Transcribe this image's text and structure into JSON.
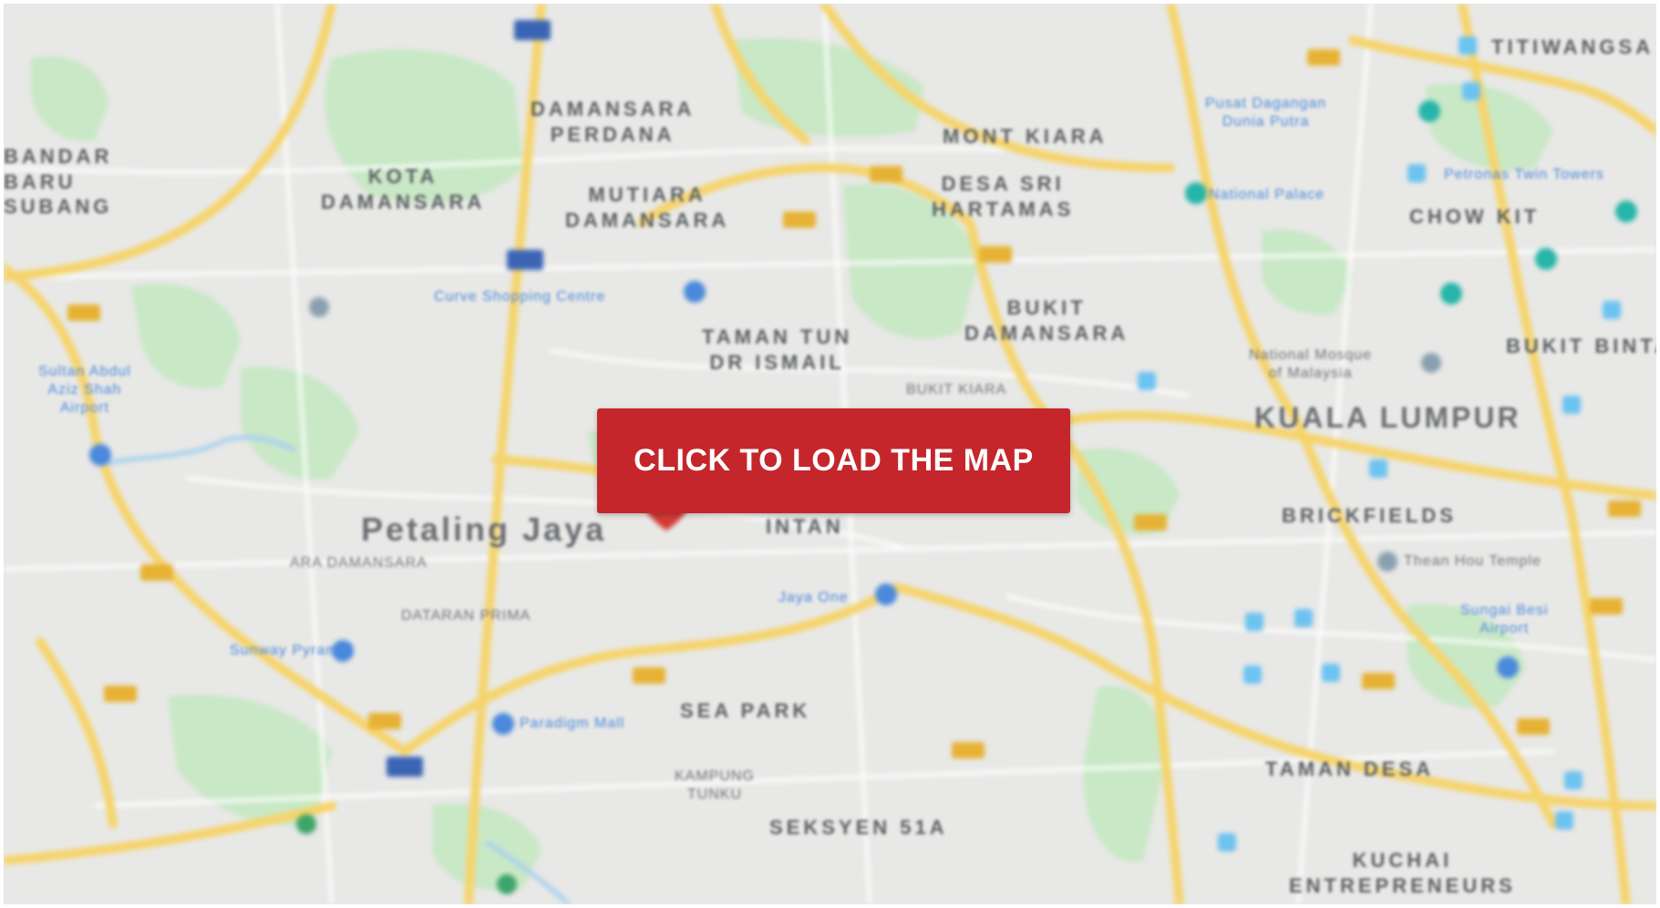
{
  "map": {
    "button_label": "CLICK TO LOAD THE MAP",
    "colors": {
      "land": "#e8e8e6",
      "park": "#c9e8c6",
      "highway": "#f6d46b",
      "road": "#ffffff",
      "button": "#c4262c",
      "pin": "#d23a35",
      "poi_blue": "#4a89dc",
      "poi_teal": "#26b5a8"
    },
    "areas": [
      "BANDAR\nBARU\nSUBANG",
      "KOTA\nDAMANSARA",
      "DAMANSARA\nPERDANA",
      "MUTIARA\nDAMANSARA",
      "MONT KIARA",
      "DESA SRI\nHARTAMAS",
      "TAMAN TUN\nDR ISMAIL",
      "BUKIT\nDAMANSARA",
      "BUKIT KIARA",
      "KUALA LUMPUR",
      "BRICKFIELDS",
      "CHOW KIT",
      "BUKIT BINTANG",
      "TITIWANGSA",
      "INTAN",
      "SEA PARK",
      "SEKSYEN 51A",
      "TAMAN DESA",
      "KUCHAI\nENTREPRENEURS",
      "ARA DAMANSARA",
      "DATARAN PRIMA",
      "KAMPUNG\nTUNKU"
    ],
    "city": "Petaling Jaya",
    "places": [
      "Sultan Abdul\nAziz Shah\nAirport",
      "Curve Shopping Centre",
      "Jaya One",
      "Paradigm Mall",
      "Sunway Pyramid",
      "National Palace",
      "Petronas Twin Towers",
      "Sungai Besi\nAirport",
      "Thean Hou Temple",
      "National Mosque\nof Malaysia",
      "Pusat Dagangan\nDunia Putra"
    ]
  }
}
